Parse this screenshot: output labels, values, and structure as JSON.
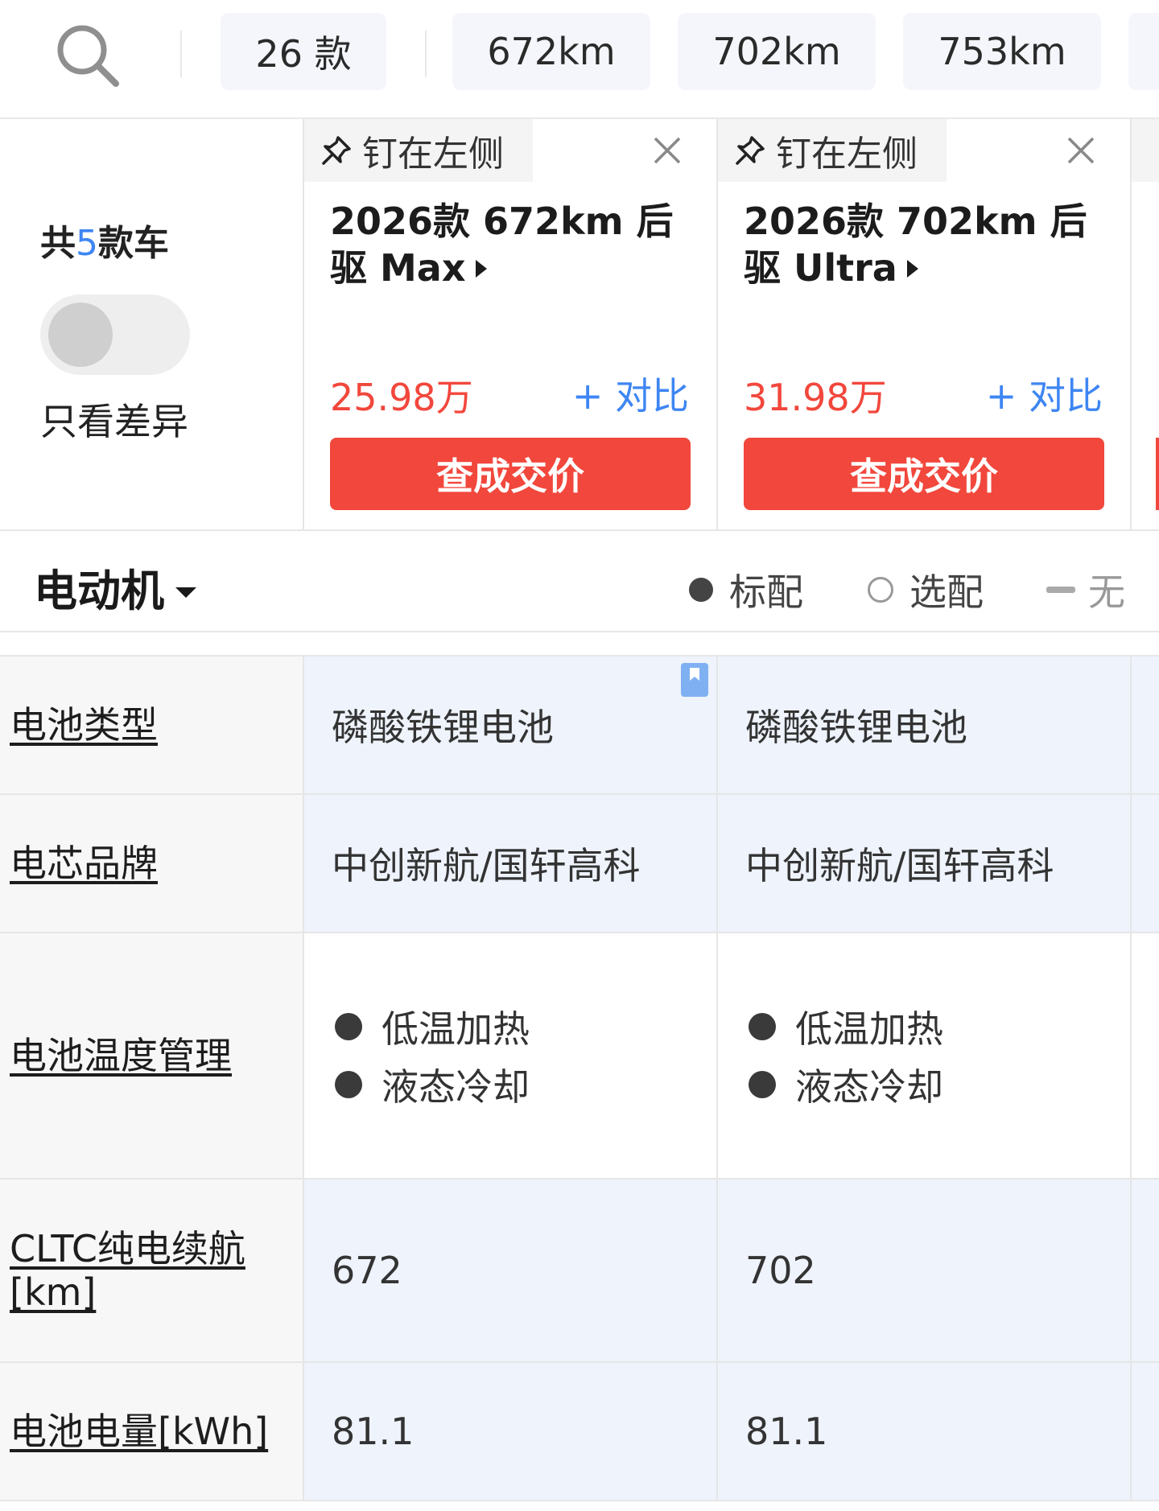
{
  "colors": {
    "accent_red": "#f2473c",
    "accent_blue": "#3e86f3",
    "cell_tint": "#eef3fc"
  },
  "filter_bar": {
    "search_icon": "search-icon",
    "chips": [
      "26 款",
      "672km",
      "702km",
      "753km"
    ]
  },
  "summary": {
    "total_prefix": "共",
    "total_count": "5",
    "total_suffix": "款车",
    "diff_toggle_label": "只看差异",
    "diff_toggle_on": false
  },
  "cars": [
    {
      "pin_label": "钉在左侧",
      "name": "2026款 672km 后驱 Max",
      "price": "25.98万",
      "compare_label": "+ 对比",
      "deal_label": "查成交价"
    },
    {
      "pin_label": "钉在左侧",
      "name": "2026款 702km 后驱 Ultra",
      "price": "31.98万",
      "compare_label": "+ 对比",
      "deal_label": "查成交价"
    }
  ],
  "section": {
    "title": "电动机",
    "legend": {
      "standard": "标配",
      "optional": "选配",
      "none": "无"
    }
  },
  "specs": [
    {
      "label": "电池类型",
      "values": [
        "磷酸铁锂电池",
        "磷酸铁锂电池"
      ]
    },
    {
      "label": "电芯品牌",
      "values": [
        "中创新航/国轩高科",
        "中创新航/国轩高科"
      ]
    },
    {
      "label": "电池温度管理",
      "values": [
        [
          "低温加热",
          "液态冷却"
        ],
        [
          "低温加热",
          "液态冷却"
        ]
      ]
    },
    {
      "label": "CLTC纯电续航[km]",
      "values": [
        "672",
        "702"
      ]
    },
    {
      "label": "电池电量[kWh]",
      "values": [
        "81.1",
        "81.1"
      ]
    }
  ]
}
